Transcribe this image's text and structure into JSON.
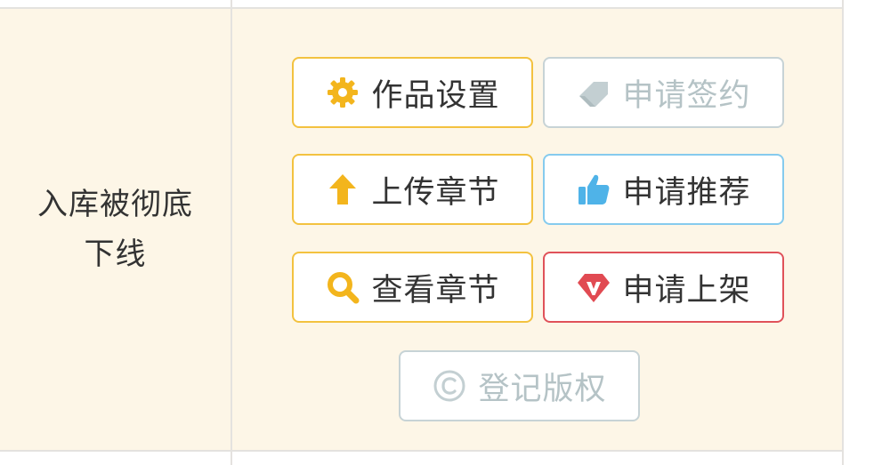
{
  "row_label": "入库被彻底\n下线",
  "buttons": {
    "work_settings": "作品设置",
    "apply_sign": "申请签约",
    "upload_chapter": "上传章节",
    "apply_recommend": "申请推荐",
    "view_chapter": "查看章节",
    "apply_shelf": "申请上架",
    "register_copyright": "登记版权"
  },
  "icons": {
    "work_settings": "gear-icon",
    "apply_sign": "eraser-tag-icon",
    "upload_chapter": "arrow-up-icon",
    "apply_recommend": "thumbs-up-icon",
    "view_chapter": "magnifier-icon",
    "apply_shelf": "v-diamond-icon",
    "register_copyright": "copyright-icon"
  },
  "colors": {
    "row_background": "#fdf6e7",
    "border_yellow": "#f3c240",
    "border_grey": "#c7d3d6",
    "border_blue": "#86cbee",
    "border_red": "#e0525a",
    "text_main": "#333333",
    "text_disabled": "#b5c3c6"
  }
}
